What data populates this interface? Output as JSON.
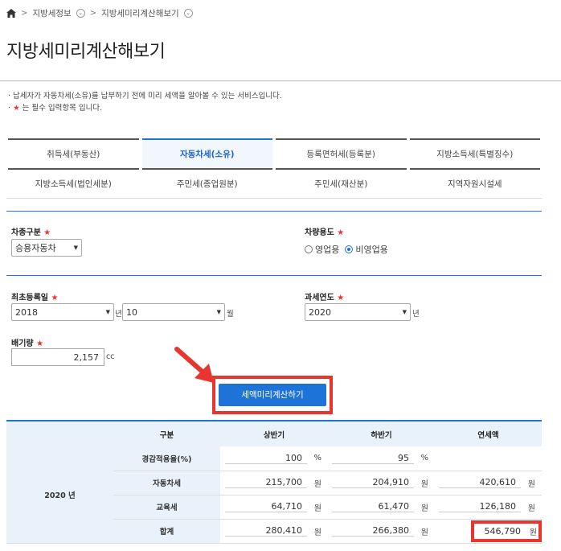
{
  "breadcrumb": {
    "level1": "지방세정보",
    "level2": "지방세미리계산해보기"
  },
  "page_title": "지방세미리계산해보기",
  "notice": {
    "line1": "· 납세자가 자동차세(소유)를 납부하기 전에 미리 세액을 알아볼 수 있는 서비스입니다.",
    "line2_prefix": "·",
    "line2_star": "★",
    "line2_text": "는 필수 입력항목 입니다."
  },
  "tabs_row1": [
    "취득세(부동산)",
    "자동차세(소유)",
    "등록면허세(등록분)",
    "지방소득세(특별징수)"
  ],
  "tabs_row2": [
    "지방소득세(법인세분)",
    "주민세(종업원분)",
    "주민세(재산분)",
    "지역자원시설세"
  ],
  "active_tab": "자동차세(소유)",
  "form": {
    "car_type": {
      "label": "차종구분",
      "value": "승용자동차"
    },
    "car_use": {
      "label": "차량용도",
      "options": [
        "영업용",
        "비영업용"
      ],
      "selected": "비영업용"
    },
    "first_reg": {
      "label": "최초등록일",
      "year": "2018",
      "year_unit": "년",
      "month": "10",
      "month_unit": "월"
    },
    "tax_year": {
      "label": "과세연도",
      "value": "2020",
      "unit": "년"
    },
    "displacement": {
      "label": "배기량",
      "value": "2,157",
      "unit": "cc"
    },
    "required_mark": "★"
  },
  "calc_button": "세액미리계산하기",
  "result": {
    "headers": [
      "구분",
      "상반기",
      "하반기",
      "연세액"
    ],
    "year_label": "2020 년",
    "rows": [
      {
        "label": "경감적용율(%)",
        "h1": "100",
        "h1_unit": "%",
        "h2": "95",
        "h2_unit": "%",
        "total": "",
        "total_unit": ""
      },
      {
        "label": "자동차세",
        "h1": "215,700",
        "h1_unit": "원",
        "h2": "204,910",
        "h2_unit": "원",
        "total": "420,610",
        "total_unit": "원"
      },
      {
        "label": "교육세",
        "h1": "64,710",
        "h1_unit": "원",
        "h2": "61,470",
        "h2_unit": "원",
        "total": "126,180",
        "total_unit": "원"
      },
      {
        "label": "합계",
        "h1": "280,410",
        "h1_unit": "원",
        "h2": "266,380",
        "h2_unit": "원",
        "total": "546,790",
        "total_unit": "원"
      }
    ]
  },
  "colors": {
    "accent": "#1e73d8",
    "highlight": "#e8352f",
    "header_bg": "#e9f2fb"
  }
}
